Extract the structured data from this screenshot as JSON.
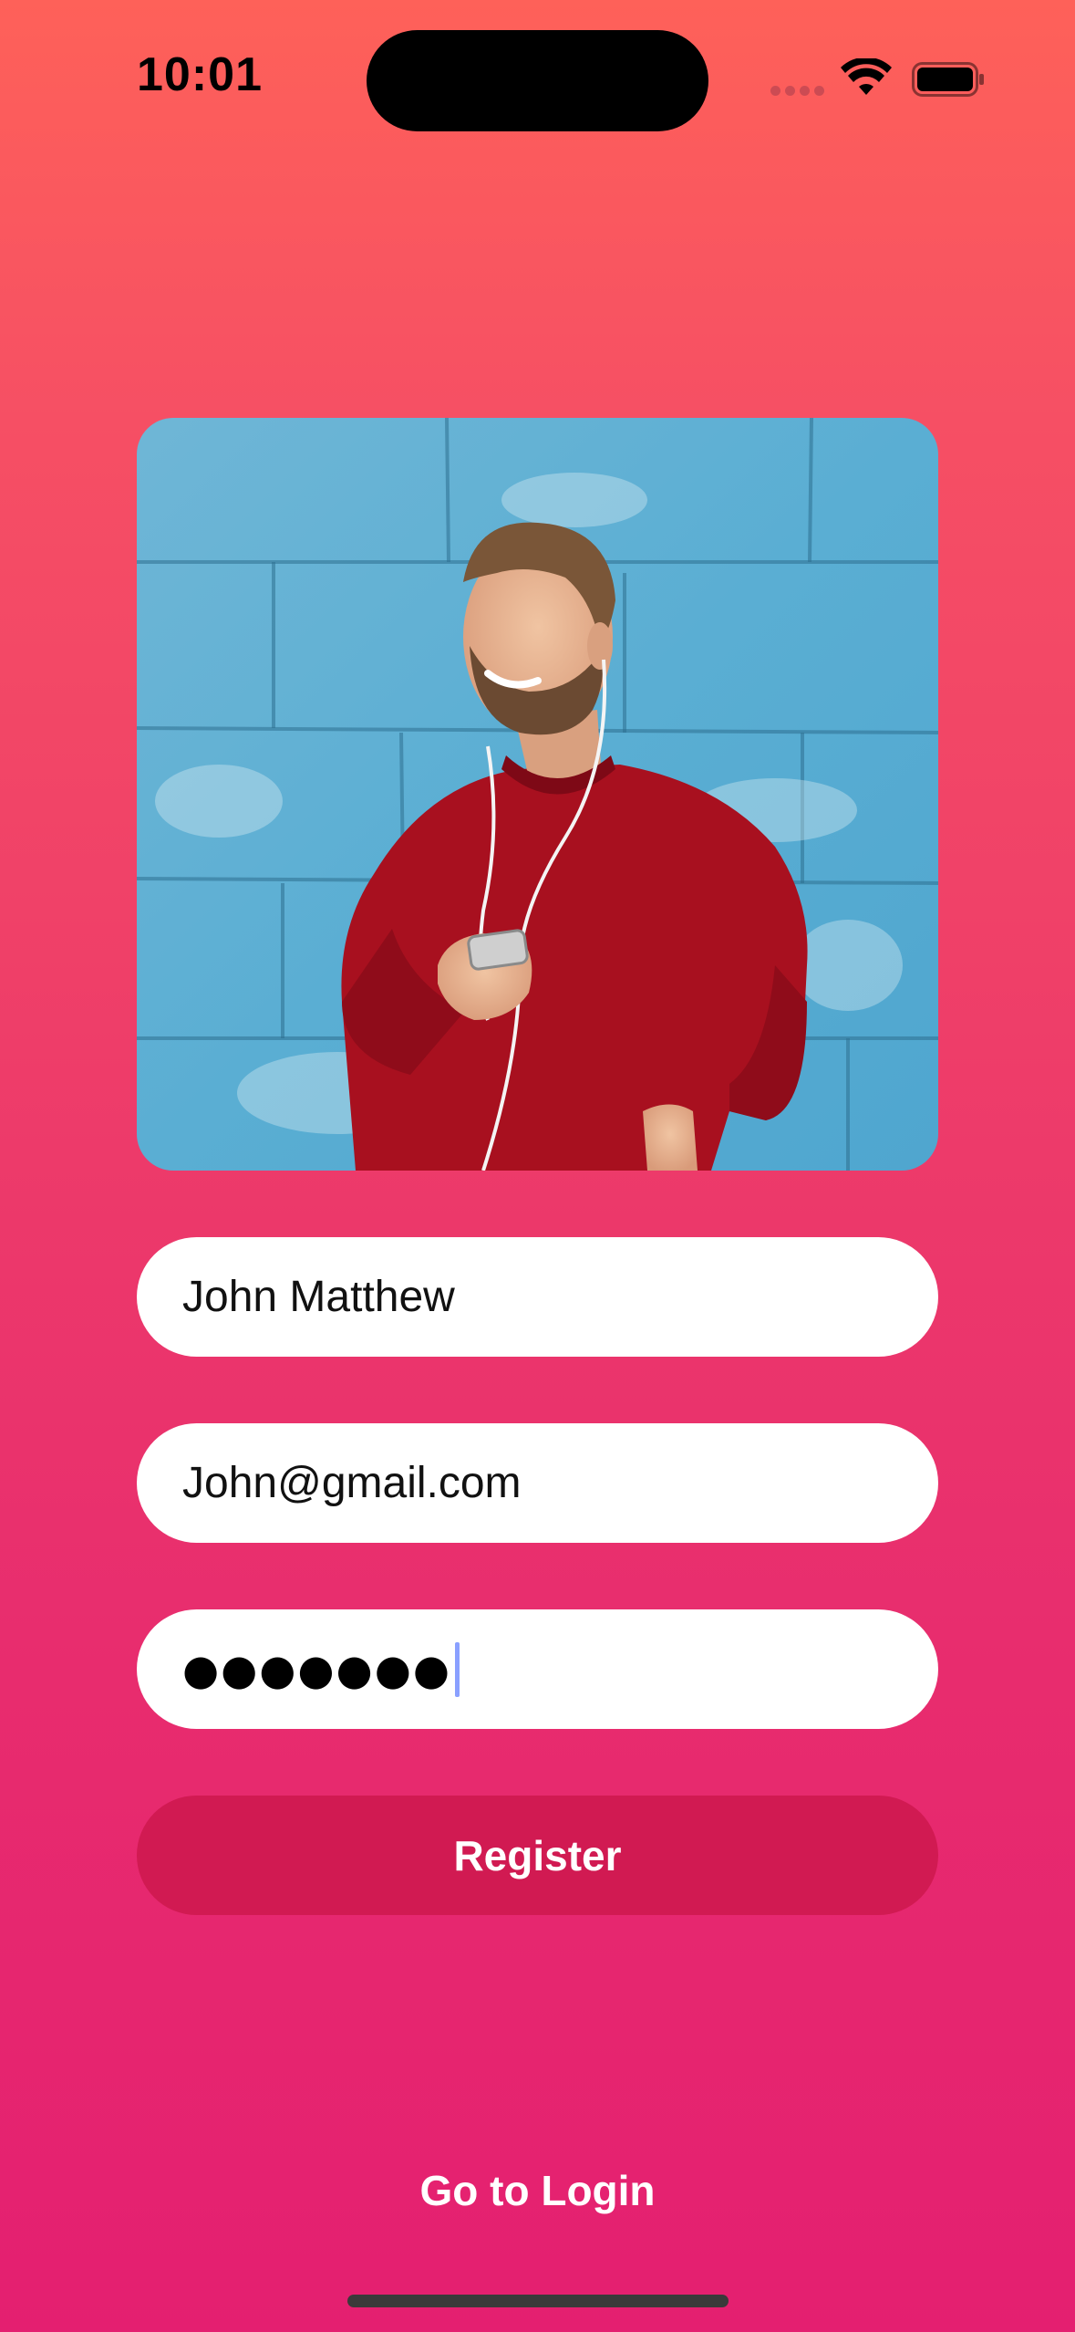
{
  "status_bar": {
    "time": "10:01"
  },
  "photo": {
    "icon": "person-photo"
  },
  "form": {
    "name_value": "John Matthew",
    "email_value": "John@gmail.com",
    "password_value": "●●●●●●●"
  },
  "actions": {
    "register_label": "Register",
    "login_label": "Go to Login"
  },
  "colors": {
    "background_top": "#fe6159",
    "background_bottom": "#e41f70",
    "button": "#d11a52",
    "caret": "#8aa0ff"
  }
}
